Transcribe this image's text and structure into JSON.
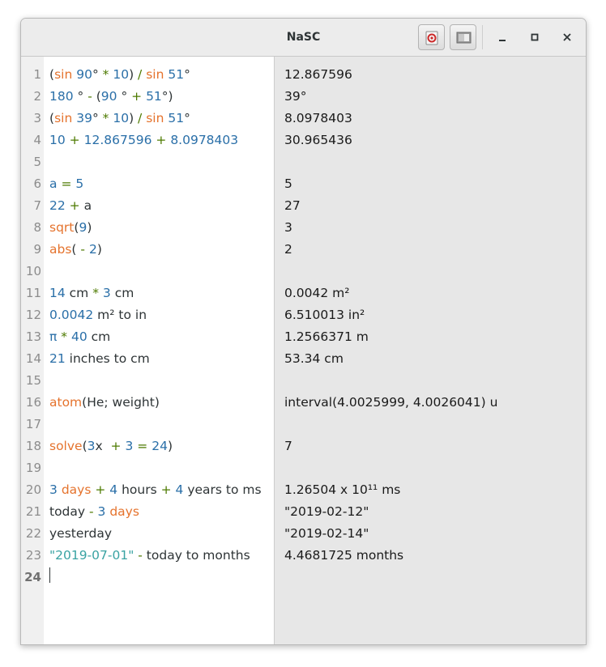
{
  "window": {
    "title": "NaSC"
  },
  "icons": {
    "help": "lifebuoy-help-icon",
    "panel": "toggle-results-panel-icon",
    "minimize": "minimize-icon",
    "maximize": "maximize-icon",
    "close": "close-icon"
  },
  "colors": {
    "function": "#e5732d",
    "number": "#2a6fa8",
    "operator": "#4d7a00",
    "string": "#3aa3a3",
    "text": "#2e3436",
    "results_bg": "#e7e7e7"
  },
  "lines": [
    {
      "num": "1",
      "result": "12.867596",
      "tokens": [
        [
          "",
          "("
        ],
        [
          "fn",
          "sin"
        ],
        [
          "",
          " "
        ],
        [
          "num",
          "90"
        ],
        [
          "",
          "° "
        ],
        [
          "op",
          "*"
        ],
        [
          "",
          " "
        ],
        [
          "num",
          "10"
        ],
        [
          "",
          ") "
        ],
        [
          "op",
          "/"
        ],
        [
          "",
          " "
        ],
        [
          "fn",
          "sin"
        ],
        [
          "",
          " "
        ],
        [
          "num",
          "51"
        ],
        [
          "",
          "°"
        ]
      ]
    },
    {
      "num": "2",
      "result": "39°",
      "tokens": [
        [
          "num",
          "180"
        ],
        [
          "",
          " ° "
        ],
        [
          "op",
          "-"
        ],
        [
          "",
          " ("
        ],
        [
          "num",
          "90"
        ],
        [
          "",
          " ° "
        ],
        [
          "op",
          "+"
        ],
        [
          "",
          " "
        ],
        [
          "num",
          "51"
        ],
        [
          "",
          "°)"
        ]
      ]
    },
    {
      "num": "3",
      "result": "8.0978403",
      "tokens": [
        [
          "",
          "("
        ],
        [
          "fn",
          "sin"
        ],
        [
          "",
          " "
        ],
        [
          "num",
          "39"
        ],
        [
          "",
          "° "
        ],
        [
          "op",
          "*"
        ],
        [
          "",
          " "
        ],
        [
          "num",
          "10"
        ],
        [
          "",
          ") "
        ],
        [
          "op",
          "/"
        ],
        [
          "",
          " "
        ],
        [
          "fn",
          "sin"
        ],
        [
          "",
          " "
        ],
        [
          "num",
          "51"
        ],
        [
          "",
          "°"
        ]
      ]
    },
    {
      "num": "4",
      "result": "30.965436",
      "tokens": [
        [
          "num",
          "10"
        ],
        [
          "",
          " "
        ],
        [
          "op",
          "+"
        ],
        [
          "",
          " "
        ],
        [
          "num",
          "12.867596"
        ],
        [
          "",
          " "
        ],
        [
          "op",
          "+"
        ],
        [
          "",
          " "
        ],
        [
          "num",
          "8.0978403"
        ]
      ]
    },
    {
      "num": "5",
      "result": "",
      "tokens": []
    },
    {
      "num": "6",
      "result": "5",
      "tokens": [
        [
          "num",
          "a"
        ],
        [
          "",
          " "
        ],
        [
          "op",
          "="
        ],
        [
          "",
          " "
        ],
        [
          "num",
          "5"
        ]
      ]
    },
    {
      "num": "7",
      "result": "27",
      "tokens": [
        [
          "num",
          "22"
        ],
        [
          "",
          " "
        ],
        [
          "op",
          "+"
        ],
        [
          "",
          " a"
        ]
      ]
    },
    {
      "num": "8",
      "result": "3",
      "tokens": [
        [
          "fn",
          "sqrt"
        ],
        [
          "",
          "("
        ],
        [
          "num",
          "9"
        ],
        [
          "",
          ")"
        ]
      ]
    },
    {
      "num": "9",
      "result": "2",
      "tokens": [
        [
          "fn",
          "abs"
        ],
        [
          "",
          "( "
        ],
        [
          "op",
          "-"
        ],
        [
          "",
          " "
        ],
        [
          "num",
          "2"
        ],
        [
          "",
          ")"
        ]
      ]
    },
    {
      "num": "10",
      "result": "",
      "tokens": []
    },
    {
      "num": "11",
      "result": "0.0042 m²",
      "tokens": [
        [
          "num",
          "14"
        ],
        [
          "",
          " cm "
        ],
        [
          "op",
          "*"
        ],
        [
          "",
          " "
        ],
        [
          "num",
          "3"
        ],
        [
          "",
          " cm"
        ]
      ]
    },
    {
      "num": "12",
      "result": "6.510013 in²",
      "tokens": [
        [
          "num",
          "0.0042"
        ],
        [
          "",
          " m² to in"
        ]
      ]
    },
    {
      "num": "13",
      "result": "1.2566371 m",
      "tokens": [
        [
          "num",
          "π"
        ],
        [
          "",
          " "
        ],
        [
          "op",
          "*"
        ],
        [
          "",
          " "
        ],
        [
          "num",
          "40"
        ],
        [
          "",
          " cm"
        ]
      ]
    },
    {
      "num": "14",
      "result": "53.34 cm",
      "tokens": [
        [
          "num",
          "21"
        ],
        [
          "",
          " inches to cm"
        ]
      ]
    },
    {
      "num": "15",
      "result": "",
      "tokens": []
    },
    {
      "num": "16",
      "result": "interval(4.0025999, 4.0026041) u",
      "tokens": [
        [
          "fn",
          "atom"
        ],
        [
          "",
          "(He; weight)"
        ]
      ]
    },
    {
      "num": "17",
      "result": "",
      "tokens": []
    },
    {
      "num": "18",
      "result": "7",
      "tokens": [
        [
          "fn",
          "solve"
        ],
        [
          "",
          "("
        ],
        [
          "num",
          "3"
        ],
        [
          "",
          "x  "
        ],
        [
          "op",
          "+"
        ],
        [
          "",
          " "
        ],
        [
          "num",
          "3"
        ],
        [
          "",
          " "
        ],
        [
          "op",
          "="
        ],
        [
          "",
          " "
        ],
        [
          "num",
          "24"
        ],
        [
          "",
          ")"
        ]
      ]
    },
    {
      "num": "19",
      "result": "",
      "tokens": []
    },
    {
      "num": "20",
      "result": "1.26504 x 10¹¹ ms",
      "tokens": [
        [
          "num",
          "3"
        ],
        [
          "",
          " "
        ],
        [
          "fn",
          "days"
        ],
        [
          "",
          " "
        ],
        [
          "op",
          "+"
        ],
        [
          "",
          " "
        ],
        [
          "num",
          "4"
        ],
        [
          "",
          " hours "
        ],
        [
          "op",
          "+"
        ],
        [
          "",
          " "
        ],
        [
          "num",
          "4"
        ],
        [
          "",
          " years to ms"
        ]
      ]
    },
    {
      "num": "21",
      "result": "\"2019-02-12\"",
      "tokens": [
        [
          "",
          "today "
        ],
        [
          "op",
          "-"
        ],
        [
          "",
          " "
        ],
        [
          "num",
          "3"
        ],
        [
          "",
          " "
        ],
        [
          "fn",
          "days"
        ]
      ]
    },
    {
      "num": "22",
      "result": "\"2019-02-14\"",
      "tokens": [
        [
          "",
          "yesterday"
        ]
      ]
    },
    {
      "num": "23",
      "result": "4.4681725 months",
      "tokens": [
        [
          "str",
          "\"2019-07-01\""
        ],
        [
          "",
          " "
        ],
        [
          "op",
          "-"
        ],
        [
          "",
          " today to months"
        ]
      ]
    },
    {
      "num": "24",
      "result": "",
      "tokens": []
    }
  ],
  "current_line": "24"
}
